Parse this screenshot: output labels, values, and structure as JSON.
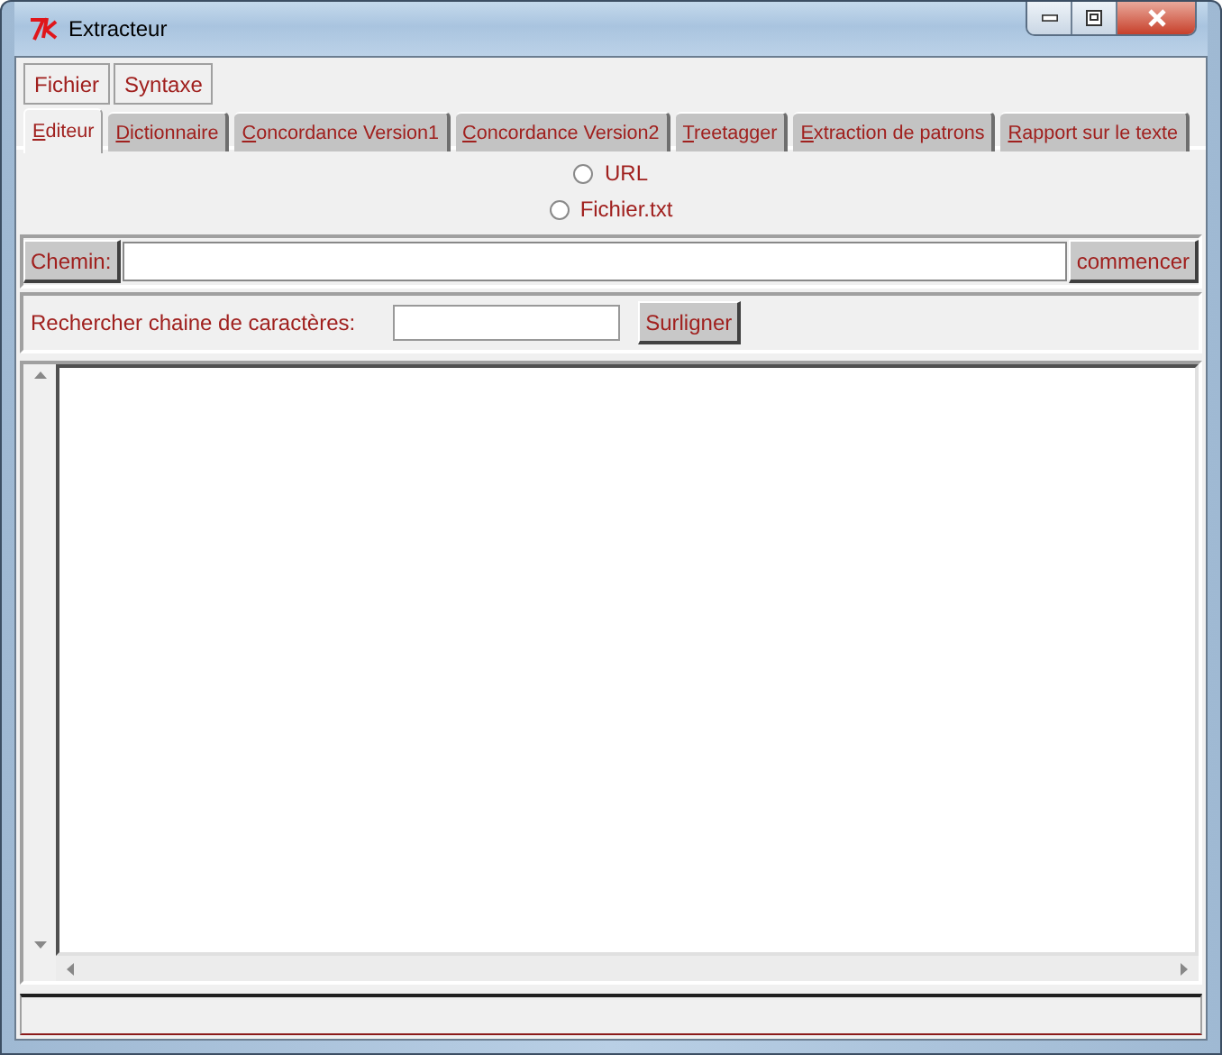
{
  "window": {
    "title": "Extracteur"
  },
  "menu": [
    {
      "label": "Fichier"
    },
    {
      "label": "Syntaxe"
    }
  ],
  "tabs": [
    {
      "label": "Editeur",
      "selected": true
    },
    {
      "label": "Dictionnaire",
      "selected": false
    },
    {
      "label": "Concordance Version1",
      "selected": false
    },
    {
      "label": "Concordance Version2",
      "selected": false
    },
    {
      "label": "Treetagger",
      "selected": false
    },
    {
      "label": "Extraction de patrons",
      "selected": false
    },
    {
      "label": "Rapport sur le texte",
      "selected": false
    }
  ],
  "source_options": [
    {
      "label": "URL",
      "selected": false
    },
    {
      "label": "Fichier.txt",
      "selected": false
    }
  ],
  "path": {
    "label": "Chemin:",
    "button": "commencer"
  },
  "search": {
    "label": "Rechercher chaine de caractères:",
    "button": "Surligner"
  }
}
